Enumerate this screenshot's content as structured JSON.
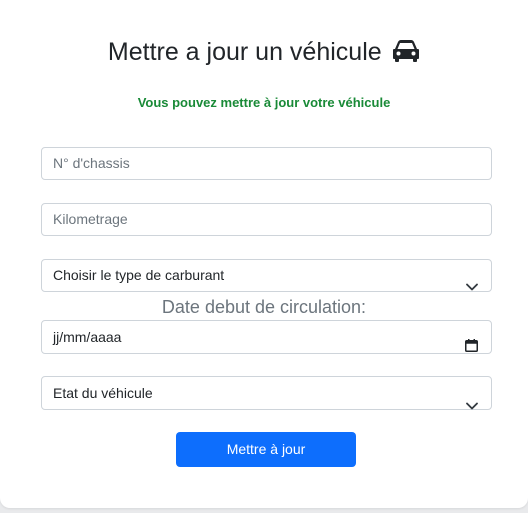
{
  "form": {
    "title": "Mettre a jour un véhicule",
    "title_icon": "car-icon",
    "subtitle": "Vous pouvez mettre à jour votre véhicule",
    "subtitle_color": "#198a37",
    "chassis_placeholder": "N° d'chassis",
    "kilometrage_placeholder": "Kilometrage",
    "fuel_select_value": "Choisir le type de carburant",
    "date_label": "Date debut de circulation:",
    "date_placeholder": "jj/mm/aaaa",
    "state_select_value": "Etat du véhicule",
    "submit_label": "Mettre à jour",
    "accent_color": "#0d6efd"
  }
}
